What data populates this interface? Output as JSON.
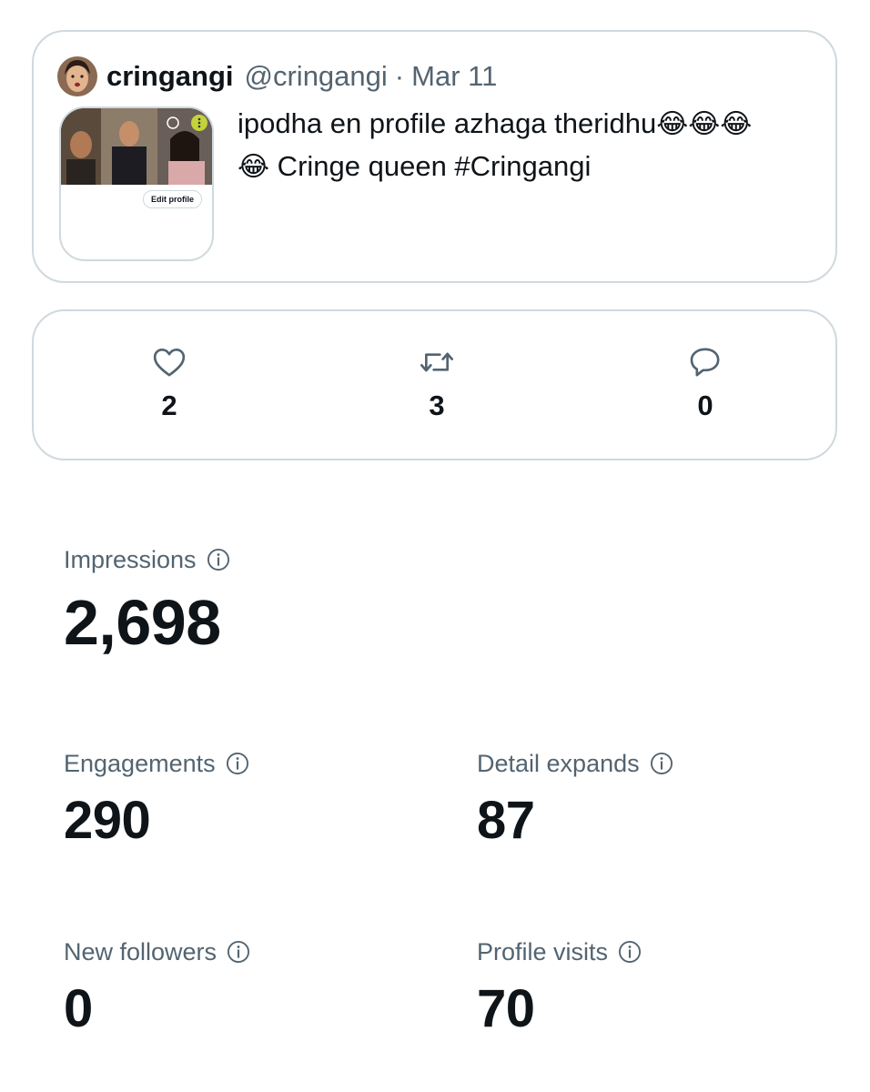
{
  "tweet": {
    "author_name": "cringangi",
    "author_handle": "@cringangi",
    "separator": "·",
    "date": "Mar 11",
    "text_line1": "ipodha en profile azhaga theridhu",
    "text_line1_emoji": "😂😂😂",
    "text_line2_emoji": "😂",
    "text_line2": " Cringe queen #Cringangi",
    "media": {
      "edit_profile_label": "Edit profile"
    }
  },
  "actions": {
    "likes": {
      "icon": "heart-icon",
      "count": "2"
    },
    "retweets": {
      "icon": "retweet-icon",
      "count": "3"
    },
    "replies": {
      "icon": "reply-icon",
      "count": "0"
    }
  },
  "analytics": {
    "impressions": {
      "label": "Impressions",
      "value": "2,698"
    },
    "engagements": {
      "label": "Engagements",
      "value": "290"
    },
    "detail_expands": {
      "label": "Detail expands",
      "value": "87"
    },
    "new_followers": {
      "label": "New followers",
      "value": "0"
    },
    "profile_visits": {
      "label": "Profile visits",
      "value": "70"
    }
  },
  "colors": {
    "primary_text": "#0f1419",
    "secondary_text": "#536471",
    "border": "#cfd9de"
  }
}
